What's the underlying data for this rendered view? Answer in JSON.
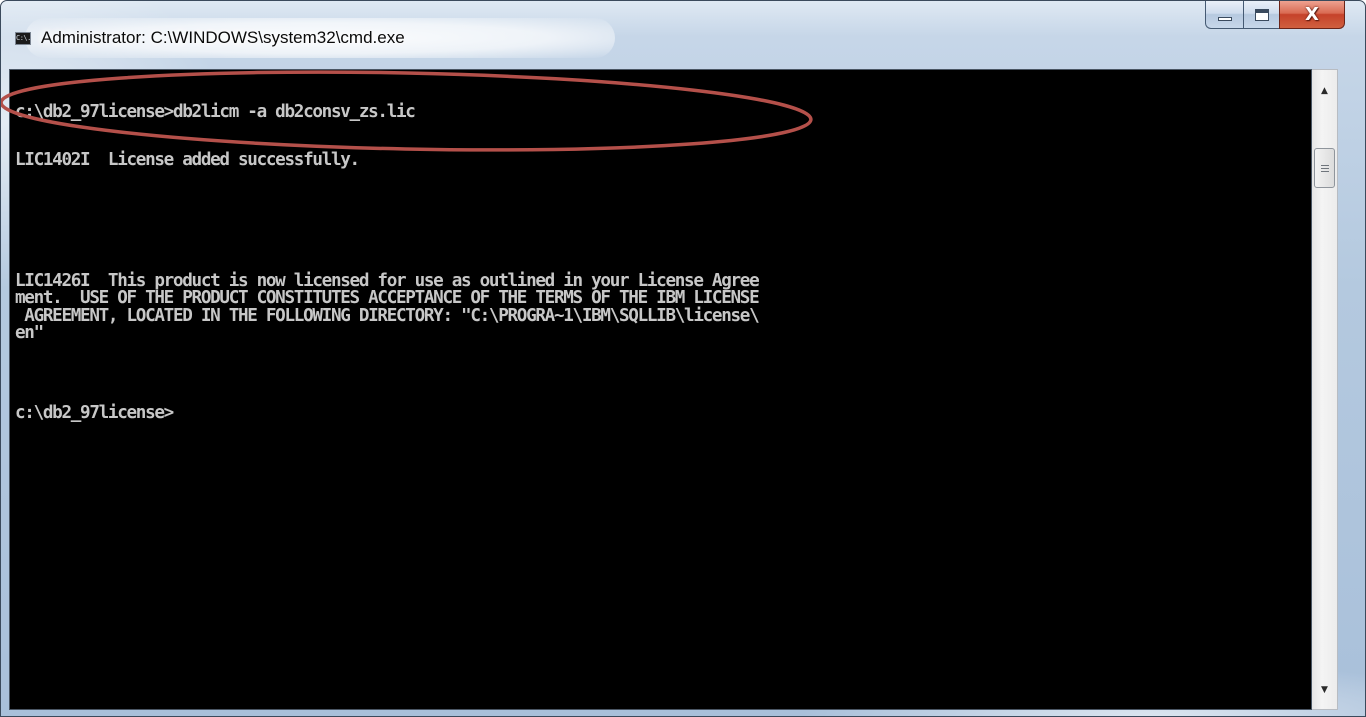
{
  "window": {
    "title": "Administrator: C:\\WINDOWS\\system32\\cmd.exe",
    "app_icon": "cmd-icon",
    "app_icon_text": "C:\\.",
    "controls": {
      "minimize_icon": "minimize-icon",
      "maximize_icon": "maximize-icon",
      "close_icon": "close-icon",
      "close_glyph": "X"
    }
  },
  "console": {
    "background": "#000000",
    "text_color": "#c7c7c7",
    "lines": [
      "c:\\db2_97license>db2licm -a db2consv_zs.lic",
      "LIC1402I  License added successfully.",
      "LIC1426I  This product is now licensed for use as outlined in your License Agree",
      "ment.  USE OF THE PRODUCT CONSTITUTES ACCEPTANCE OF THE TERMS OF THE IBM LICENSE",
      " AGREEMENT, LOCATED IN THE FOLLOWING DIRECTORY: \"C:\\PROGRA~1\\IBM\\SQLLIB\\license\\",
      "en\"",
      "c:\\db2_97license>"
    ]
  },
  "scrollbar": {
    "up_arrow_icon": "scroll-up-arrow-icon",
    "down_arrow_icon": "scroll-down-arrow-icon",
    "up_glyph": "▲",
    "down_glyph": "▼"
  },
  "annotation": {
    "shape": "ellipse",
    "color": "#b4504a",
    "highlights": "command line"
  }
}
